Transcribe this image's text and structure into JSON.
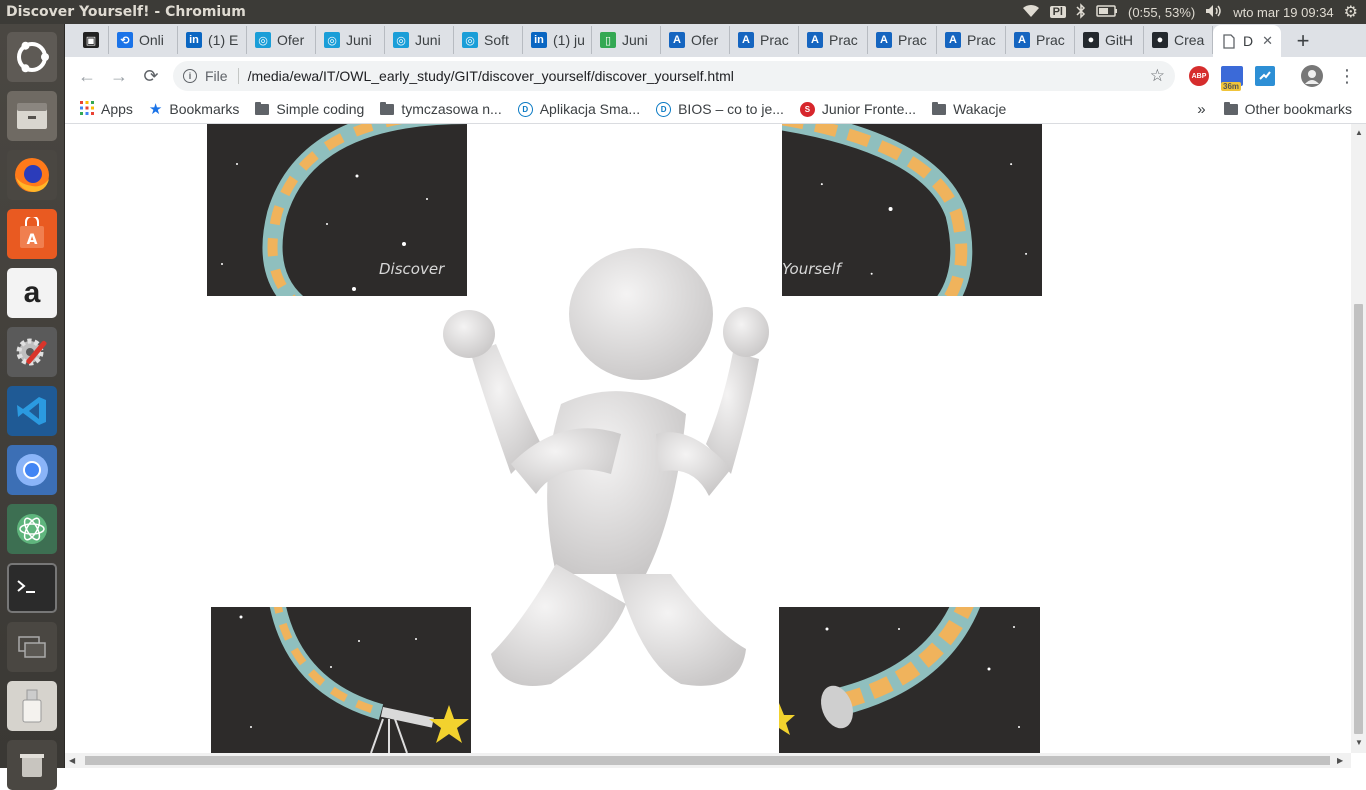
{
  "window": {
    "title": "Discover Yourself! - Chromium"
  },
  "system_tray": {
    "keyboard_layout": "Pl",
    "battery": "(0:55, 53%)",
    "clock": "wto mar 19 09:34"
  },
  "tabs": [
    {
      "label": "Onli",
      "favicon": "sync-icon",
      "color": "#1a73e8"
    },
    {
      "label": "(1) E",
      "favicon": "linkedin-icon",
      "color": "#0a66c2"
    },
    {
      "label": "Ofer",
      "favicon": "target-icon",
      "color": "#1a9ed8"
    },
    {
      "label": "Juni",
      "favicon": "target-icon",
      "color": "#1a9ed8"
    },
    {
      "label": "Juni",
      "favicon": "target-icon",
      "color": "#1a9ed8"
    },
    {
      "label": "Soft",
      "favicon": "target-icon",
      "color": "#1a9ed8"
    },
    {
      "label": "(1) ju",
      "favicon": "linkedin-icon",
      "color": "#0a66c2"
    },
    {
      "label": "Juni",
      "favicon": "phone-icon",
      "color": "#34a853"
    },
    {
      "label": "Ofer",
      "favicon": "a-letter-icon",
      "color": "#1565c0"
    },
    {
      "label": "Prac",
      "favicon": "a-letter-icon",
      "color": "#1565c0"
    },
    {
      "label": "Prac",
      "favicon": "a-letter-icon",
      "color": "#1565c0"
    },
    {
      "label": "Prac",
      "favicon": "a-letter-icon",
      "color": "#1565c0"
    },
    {
      "label": "Prac",
      "favicon": "a-letter-icon",
      "color": "#1565c0"
    },
    {
      "label": "Prac",
      "favicon": "a-letter-icon",
      "color": "#1565c0"
    },
    {
      "label": "GitH",
      "favicon": "github-icon",
      "color": "#24292e"
    },
    {
      "label": "Crea",
      "favicon": "github-icon",
      "color": "#24292e"
    }
  ],
  "active_tab": {
    "label": "D",
    "favicon": "page-icon"
  },
  "omnibox": {
    "scheme": "File",
    "url": "/media/ewa/IT/OWL_early_study/GIT/discover_yourself/discover_yourself.html"
  },
  "extensions": {
    "adblock": "ABP",
    "timer": "36m"
  },
  "bookmarks": {
    "apps": "Apps",
    "items": [
      {
        "label": "Bookmarks",
        "icon": "star-icon"
      },
      {
        "label": "Simple coding",
        "icon": "folder-icon"
      },
      {
        "label": "tymczasowa n...",
        "icon": "folder-icon"
      },
      {
        "label": "Aplikacja Sma...",
        "icon": "dell-icon"
      },
      {
        "label": "BIOS – co to je...",
        "icon": "dell-icon"
      },
      {
        "label": "Junior Fronte...",
        "icon": "s-logo-icon"
      },
      {
        "label": "Wakacje",
        "icon": "folder-icon"
      }
    ],
    "overflow": "»",
    "other": "Other bookmarks"
  },
  "page": {
    "caption_left": "Discover",
    "caption_right": "Yourself"
  },
  "colors": {
    "map_orange": "#f0b35c",
    "map_teal": "#8fbfbe",
    "space": "#2d2b2a",
    "figure": "#e4e3e3",
    "star_yellow": "#f2d22e"
  }
}
